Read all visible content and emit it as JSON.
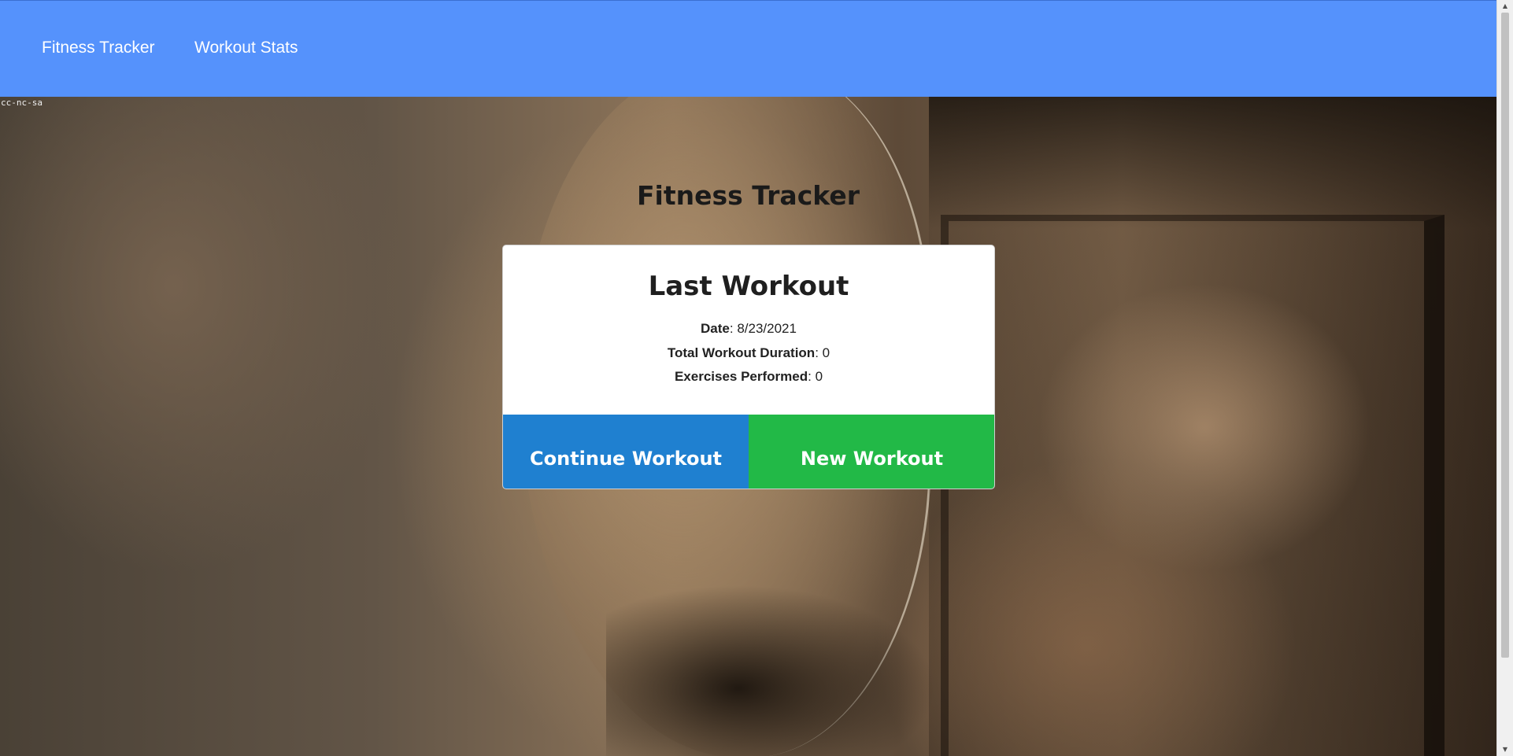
{
  "navbar": {
    "brand": "Fitness Tracker",
    "links": [
      {
        "label": "Workout Stats"
      }
    ],
    "background_color": "#5592fc"
  },
  "hero": {
    "watermark": "cc-nc-sa",
    "title": "Fitness Tracker"
  },
  "last_workout": {
    "title": "Last Workout",
    "stats": [
      {
        "label": "Date",
        "value": ": 8/23/2021"
      },
      {
        "label": "Total Workout Duration",
        "value": ": 0"
      },
      {
        "label": "Exercises Performed",
        "value": ": 0"
      }
    ],
    "buttons": {
      "continue_label": "Continue Workout",
      "continue_color": "#1f80d0",
      "new_label": "New Workout",
      "new_color": "#22b947"
    }
  },
  "scrollbar": {
    "up_icon": "arrow-up-icon",
    "down_icon": "arrow-down-icon"
  }
}
